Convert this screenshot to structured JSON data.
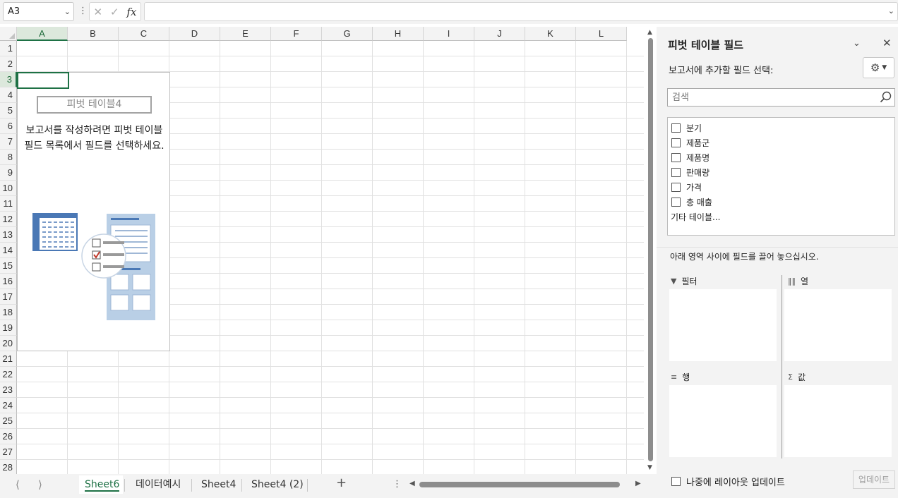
{
  "formula_bar": {
    "name_box": "A3",
    "formula": ""
  },
  "grid": {
    "columns": [
      "A",
      "B",
      "C",
      "D",
      "E",
      "F",
      "G",
      "H",
      "I",
      "J",
      "K",
      "L"
    ],
    "rows": [
      "1",
      "2",
      "3",
      "4",
      "5",
      "6",
      "7",
      "8",
      "9",
      "10",
      "11",
      "12",
      "13",
      "14",
      "15",
      "16",
      "17",
      "18",
      "19",
      "20",
      "21",
      "22",
      "23",
      "24",
      "25",
      "26",
      "27",
      "28"
    ],
    "active_col": "A",
    "active_row": "3"
  },
  "pivot_placeholder": {
    "name": "피벗 테이블4",
    "instruction": "보고서를 작성하려면 피벗 테이블 필드 목록에서 필드를 선택하세요."
  },
  "sheet_tabs": [
    {
      "label": "Sheet6",
      "active": true
    },
    {
      "label": "데이터예시",
      "active": false
    },
    {
      "label": "Sheet4",
      "active": false
    },
    {
      "label": "Sheet4 (2)",
      "active": false
    }
  ],
  "panel": {
    "title": "피벗 테이블 필드",
    "subtitle": "보고서에 추가할 필드 선택:",
    "search_placeholder": "검색",
    "fields": [
      "분기",
      "제품군",
      "제품명",
      "판매량",
      "가격",
      "총 매출"
    ],
    "more_tables": "기타 테이블...",
    "drag_hint": "아래 영역 사이에 필드를 끌어 놓으십시오.",
    "areas": {
      "filter": "필터",
      "columns": "열",
      "rows": "행",
      "values": "값"
    },
    "defer_label": "나중에 레이아웃 업데이트",
    "update_label": "업데이트"
  },
  "colors": {
    "accent": "#1e7145",
    "header_bg": "#f3f3f3",
    "illustration_blue": "#4a78b5"
  }
}
